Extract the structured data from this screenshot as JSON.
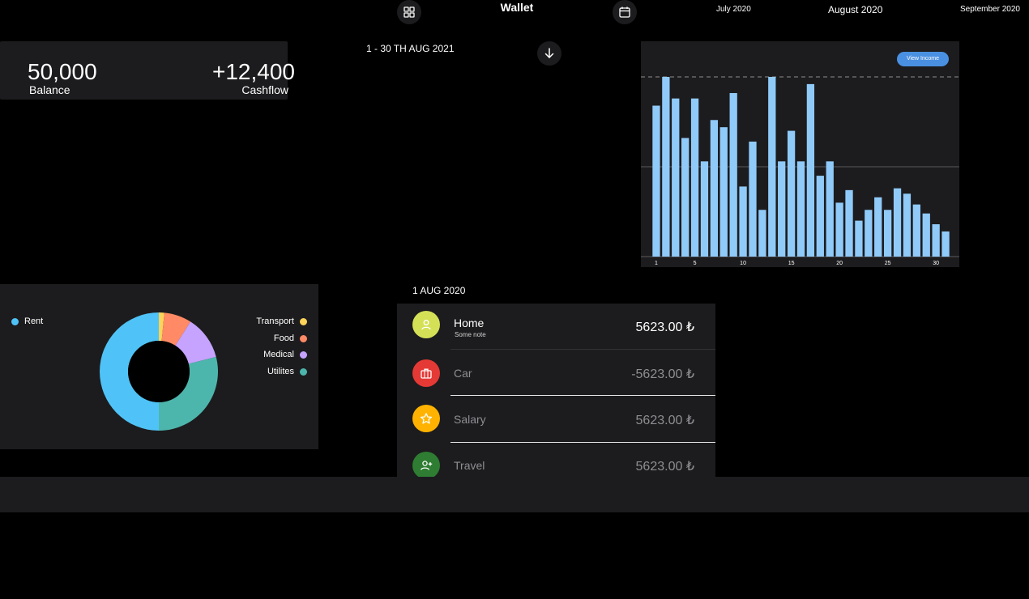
{
  "header": {
    "title": "Wallet",
    "months": [
      "July 2020",
      "August 2020",
      "September 2020"
    ],
    "active_month_index": 1,
    "left_icon": "grid-icon",
    "right_icon": "calendar-icon"
  },
  "balance": {
    "amount": "50,000",
    "amount_label": "Balance",
    "cashflow": "+12,400",
    "cashflow_label": "Cashflow"
  },
  "period": {
    "label": "1 - 30 TH AUG 2021",
    "action_icon": "arrow-down-icon"
  },
  "income_chart": {
    "button_label": "View Income",
    "bar_color": "#90caf9"
  },
  "chart_data": {
    "type": "bar",
    "x": [
      1,
      2,
      3,
      4,
      5,
      6,
      7,
      8,
      9,
      10,
      11,
      12,
      13,
      14,
      15,
      16,
      17,
      18,
      19,
      20,
      21,
      22,
      23,
      24,
      25,
      26,
      27,
      28,
      29,
      30,
      31
    ],
    "values": [
      84,
      100,
      88,
      66,
      88,
      53,
      76,
      72,
      91,
      39,
      64,
      26,
      100,
      53,
      70,
      53,
      96,
      45,
      53,
      30,
      37,
      20,
      26,
      33,
      26,
      38,
      35,
      29,
      24,
      18,
      14
    ],
    "xticks": [
      "1",
      "5",
      "10",
      "15",
      "20",
      "25",
      "30"
    ],
    "xtick_positions": [
      1,
      5,
      10,
      15,
      20,
      25,
      30
    ],
    "ylim": [
      0,
      100
    ],
    "reference_line": 100,
    "grid": true
  },
  "categories": {
    "items": [
      {
        "name": "Rent",
        "value": 50,
        "color": "#4fc3f7"
      },
      {
        "name": "Transport",
        "value": 1.5,
        "color": "#fdd35a"
      },
      {
        "name": "Food",
        "value": 7.5,
        "color": "#ff8a65"
      },
      {
        "name": "Medical",
        "value": 12,
        "color": "#c5a3ff"
      },
      {
        "name": "Utilites",
        "value": 29,
        "color": "#4db6ac"
      }
    ]
  },
  "transactions": {
    "date": "1 AUG 2020",
    "items": [
      {
        "title": "Home",
        "note": "Some note",
        "amount": "5623.00 ₺",
        "icon": "user-icon",
        "icon_bg": "#d4e157",
        "highlight": true
      },
      {
        "title": "Car",
        "note": "",
        "amount": "-5623.00 ₺",
        "icon": "briefcase-icon",
        "icon_bg": "#e53935",
        "highlight": false
      },
      {
        "title": "Salary",
        "note": "",
        "amount": "5623.00 ₺",
        "icon": "star-icon",
        "icon_bg": "#ffb300",
        "highlight": false
      },
      {
        "title": "Travel",
        "note": "",
        "amount": "5623.00 ₺",
        "icon": "user-plus-icon",
        "icon_bg": "#2e7d32",
        "highlight": false
      }
    ]
  }
}
